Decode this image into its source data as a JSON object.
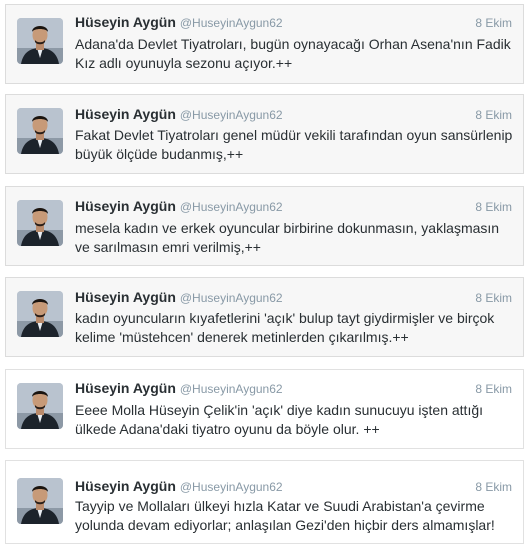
{
  "tweets": [
    {
      "name": "Hüseyin Aygün",
      "handle": "@HuseyinAygun62",
      "time": "8 Ekim",
      "text": "Adana'da Devlet Tiyatroları, bugün oynayacağı Orhan Asena'nın Fadik Kız adlı oyunuyla sezonu açıyor.++"
    },
    {
      "name": "Hüseyin Aygün",
      "handle": "@HuseyinAygun62",
      "time": "8 Ekim",
      "text": "Fakat Devlet Tiyatroları genel müdür vekili tarafından oyun sansürlenip büyük ölçüde budanmış,++"
    },
    {
      "name": "Hüseyin Aygün",
      "handle": "@HuseyinAygun62",
      "time": "8 Ekim",
      "text": "mesela kadın ve erkek oyuncular birbirine dokunmasın, yaklaşmasın ve sarılmasın emri verilmiş,++"
    },
    {
      "name": "Hüseyin Aygün",
      "handle": "@HuseyinAygun62",
      "time": "8 Ekim",
      "text": "kadın oyuncuların kıyafetlerini 'açık' bulup tayt giydirmişler ve birçok kelime 'müstehcen' denerek metinlerden çıkarılmış.++"
    },
    {
      "name": "Hüseyin Aygün",
      "handle": "@HuseyinAygun62",
      "time": "8 Ekim",
      "text": "Eeee Molla Hüseyin Çelik'in 'açık' diye kadın sunucuyu işten attığı ülkede Adana'daki tiyatro oyunu da böyle olur. ++"
    },
    {
      "name": "Hüseyin Aygün",
      "handle": "@HuseyinAygun62",
      "time": "8 Ekim",
      "text": "Tayyip ve Mollaları ülkeyi hızla Katar ve Suudi Arabistan'a çevirme yolunda devam ediyorlar; anlaşılan Gezi'den hiçbir ders almamışlar!"
    }
  ]
}
